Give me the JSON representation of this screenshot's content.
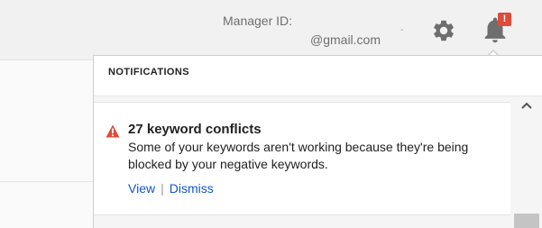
{
  "header": {
    "manager_label": "Manager ID:",
    "account_email": "@gmail.com",
    "account_separator": "-",
    "notification_count": "!",
    "icons": {
      "settings": "gear-icon",
      "notifications": "bell-icon"
    },
    "colors": {
      "badge": "#dd4b39",
      "bar": "#f1f1f1"
    }
  },
  "notifications": {
    "title": "NOTIFICATIONS",
    "items": [
      {
        "icon": "warning-icon",
        "title": "27 keyword conflicts",
        "message": "Some of your keywords aren't working because they're being blocked by your negative keywords.",
        "actions": {
          "view": "View",
          "separator": "|",
          "dismiss": "Dismiss"
        }
      }
    ]
  },
  "colors": {
    "link": "#1155cc",
    "warning": "#dd4b39"
  }
}
